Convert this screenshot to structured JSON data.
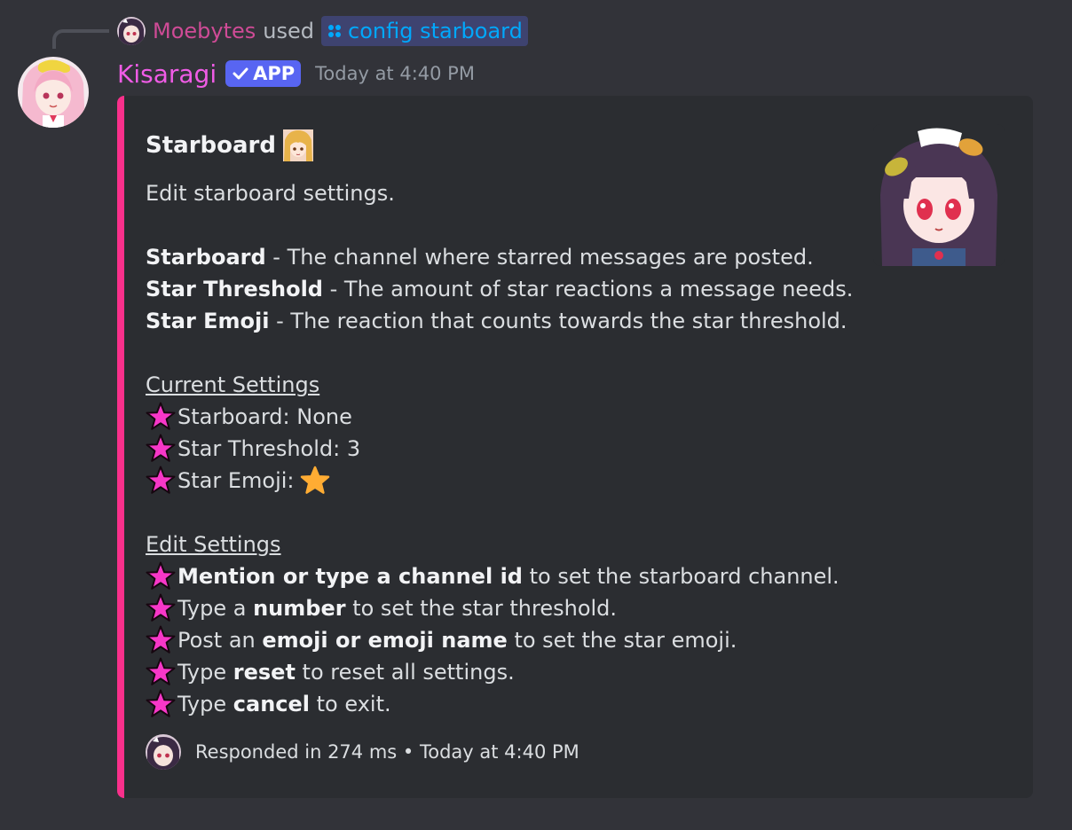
{
  "reply": {
    "username": "Moebytes",
    "used_text": "used",
    "command": "config starboard",
    "avatar_icon": "user-avatar-icon",
    "command_icon": "slash-command-icon"
  },
  "author": {
    "name": "Kisaragi",
    "badge": "APP",
    "badge_icon": "checkmark-icon",
    "timestamp": "Today at 4:40 PM",
    "name_color": "#f05ce6"
  },
  "embed": {
    "accent_color": "#f9308b",
    "title": "Starboard",
    "title_emoji": "anime-emoji-icon",
    "intro": "Edit starboard settings.",
    "definitions": [
      {
        "term": "Starboard",
        "text": " - The channel where starred messages are posted."
      },
      {
        "term": "Star Threshold",
        "text": " - The amount of star reactions a message needs."
      },
      {
        "term": "Star Emoji",
        "text": " - The reaction that counts towards the star threshold."
      }
    ],
    "current_heading": "Current Settings",
    "current": [
      {
        "text": "Starboard: None"
      },
      {
        "text": "Star Threshold: 3"
      },
      {
        "text": "Star Emoji:",
        "emoji": "star-emoji-icon"
      }
    ],
    "edit_heading": "Edit Settings",
    "edit": [
      {
        "pre": "",
        "bold": "Mention or type a channel id",
        "post": " to set the starboard channel."
      },
      {
        "pre": "Type a ",
        "bold": "number",
        "post": " to set the star threshold."
      },
      {
        "pre": "Post an ",
        "bold": "emoji or emoji name",
        "post": " to set the star emoji."
      },
      {
        "pre": "Type ",
        "bold": "reset",
        "post": " to reset all settings."
      },
      {
        "pre": "Type ",
        "bold": "cancel",
        "post": " to exit."
      }
    ],
    "footer": "Responded in 274 ms • Today at 4:40 PM"
  },
  "colors": {
    "background": "#323339",
    "embed_bg": "#2b2d31",
    "bullet_star": "#f737c8",
    "command_bg": "#3e4370",
    "command_text": "#00a8fc",
    "app_badge": "#5865f2"
  }
}
